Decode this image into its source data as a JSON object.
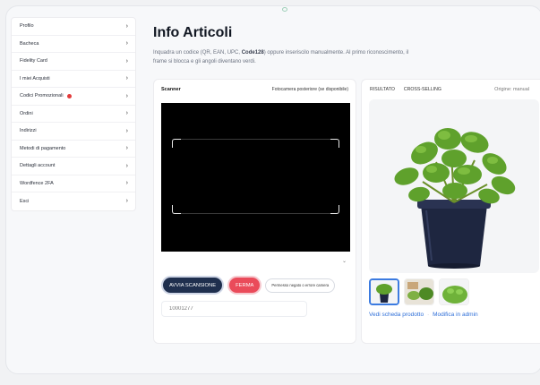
{
  "sidebar": {
    "items": [
      {
        "label": "Profilo",
        "badge": false
      },
      {
        "label": "Bacheca",
        "badge": false
      },
      {
        "label": "Fidelity Card",
        "badge": false
      },
      {
        "label": "I miei Acquisti",
        "badge": false
      },
      {
        "label": "Codici Promozionali",
        "badge": true
      },
      {
        "label": "Ordini",
        "badge": false
      },
      {
        "label": "Indirizzi",
        "badge": false
      },
      {
        "label": "Metodi di pagamento",
        "badge": false
      },
      {
        "label": "Dettagli account",
        "badge": false
      },
      {
        "label": "Wordfence 2FA",
        "badge": false
      },
      {
        "label": "Esci",
        "badge": false
      }
    ],
    "chevron": "›",
    "badge_color": "#e23a3a"
  },
  "header": {
    "title": "Info Articoli",
    "desc_before": "Inquadra un codice (QR, EAN, UPC, ",
    "desc_bold": "Code128",
    "desc_after": ") oppure inseriscilo manualmente. Al primo riconoscimento, il frame si blocca e gli angoli diventano verdi."
  },
  "scanner": {
    "title": "Scanner",
    "camera_label": "Fotocamera posteriore (se disponibile)",
    "start_label": "AVVIA SCANSIONE",
    "stop_label": "FERMA",
    "permission_label": "Permesso negato o errore camera",
    "input_placeholder": "10001277",
    "dropdown_icon": "chevron-down-icon"
  },
  "result": {
    "tabs": [
      "RISULTATO",
      "CROSS-SELLING"
    ],
    "origin": "Origine: manual",
    "link_product": "Vedi scheda prodotto",
    "separator": "·",
    "link_admin": "Modifica in admin"
  },
  "colors": {
    "primary_button": "#1f2f4e",
    "stop_button": "#ea4b5a",
    "link": "#2f6fd8",
    "active_thumb": "#3c7be0"
  }
}
